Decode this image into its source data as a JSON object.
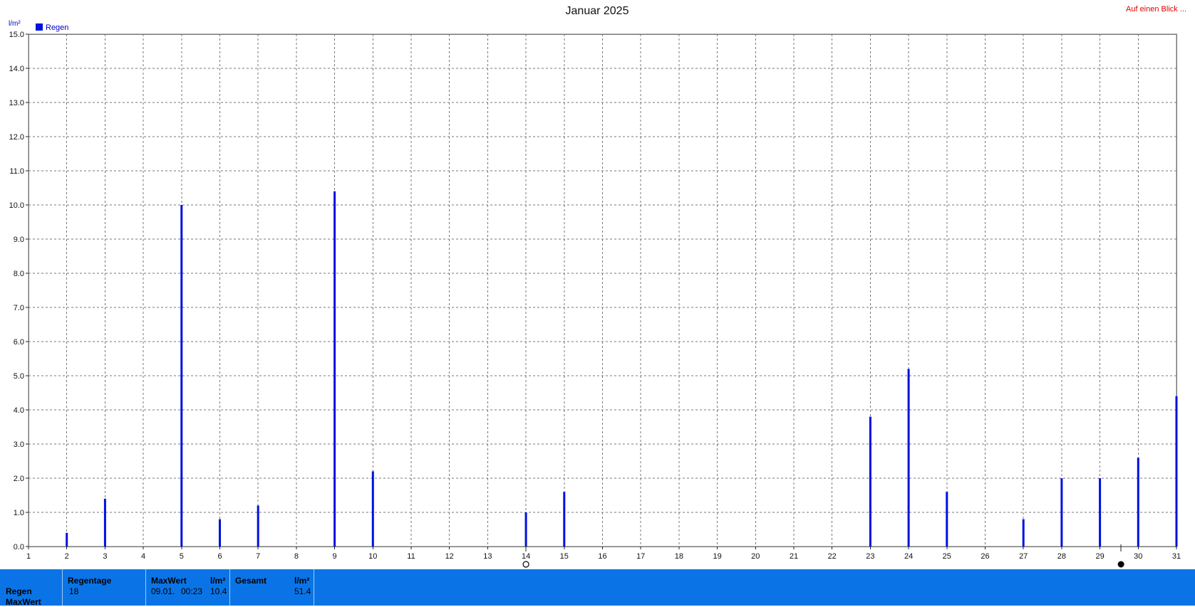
{
  "header": {
    "title": "Januar 2025",
    "link": "Auf einen Blick ...",
    "unit": "l/m²",
    "legend": "Regen"
  },
  "colors": {
    "bar": "#0010e0",
    "legend_swatch": "#0010e0",
    "stats_bg": "#0a74e6",
    "link": "#e00000"
  },
  "chart_data": {
    "type": "bar",
    "title": "Januar 2025",
    "ylabel": "l/m²",
    "xlabel": "",
    "xlim": [
      1,
      31
    ],
    "ylim": [
      0,
      15
    ],
    "x_ticks": [
      "1",
      "2",
      "3",
      "4",
      "5",
      "6",
      "7",
      "8",
      "9",
      "10",
      "11",
      "12",
      "13",
      "14",
      "15",
      "16",
      "17",
      "18",
      "19",
      "20",
      "21",
      "22",
      "23",
      "24",
      "25",
      "26",
      "27",
      "28",
      "29",
      "30",
      "31"
    ],
    "y_ticks": [
      "0.0",
      "1.0",
      "2.0",
      "3.0",
      "4.0",
      "5.0",
      "6.0",
      "7.0",
      "8.0",
      "9.0",
      "10.0",
      "11.0",
      "12.0",
      "13.0",
      "14.0",
      "15.0"
    ],
    "grid": true,
    "legend_position": "top-left",
    "series": [
      {
        "name": "Regen",
        "x": [
          2,
          3,
          5,
          6,
          7,
          9,
          10,
          14,
          15,
          23,
          24,
          25,
          27,
          28,
          29,
          30,
          31
        ],
        "values": [
          0.4,
          1.4,
          10.0,
          0.8,
          1.2,
          10.4,
          2.2,
          1.0,
          1.6,
          3.8,
          5.2,
          1.6,
          0.8,
          2.0,
          2.0,
          2.6,
          4.4
        ]
      }
    ],
    "markers": [
      {
        "x": 14,
        "type": "open-circle"
      },
      {
        "x": 29.55,
        "type": "filled-circle"
      }
    ]
  },
  "stats": {
    "row_labels": [
      "Regen",
      "MaxWert"
    ],
    "regentage_header": "Regentage",
    "regentage_value": "18",
    "maxwert_header": "MaxWert",
    "maxwert_unit": "l/m²",
    "maxwert_date": "09.01.",
    "maxwert_time": "00:23",
    "maxwert_value": "10.4",
    "gesamt_header": "Gesamt",
    "gesamt_unit": "l/m²",
    "gesamt_value": "51.4"
  }
}
